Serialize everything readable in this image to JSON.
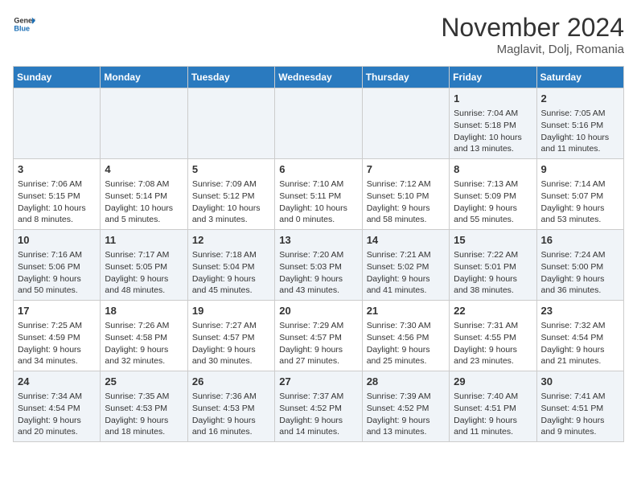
{
  "header": {
    "logo_line1": "General",
    "logo_line2": "Blue",
    "month": "November 2024",
    "location": "Maglavit, Dolj, Romania"
  },
  "weekdays": [
    "Sunday",
    "Monday",
    "Tuesday",
    "Wednesday",
    "Thursday",
    "Friday",
    "Saturday"
  ],
  "weeks": [
    [
      {
        "day": "",
        "info": ""
      },
      {
        "day": "",
        "info": ""
      },
      {
        "day": "",
        "info": ""
      },
      {
        "day": "",
        "info": ""
      },
      {
        "day": "",
        "info": ""
      },
      {
        "day": "1",
        "info": "Sunrise: 7:04 AM\nSunset: 5:18 PM\nDaylight: 10 hours and 13 minutes."
      },
      {
        "day": "2",
        "info": "Sunrise: 7:05 AM\nSunset: 5:16 PM\nDaylight: 10 hours and 11 minutes."
      }
    ],
    [
      {
        "day": "3",
        "info": "Sunrise: 7:06 AM\nSunset: 5:15 PM\nDaylight: 10 hours and 8 minutes."
      },
      {
        "day": "4",
        "info": "Sunrise: 7:08 AM\nSunset: 5:14 PM\nDaylight: 10 hours and 5 minutes."
      },
      {
        "day": "5",
        "info": "Sunrise: 7:09 AM\nSunset: 5:12 PM\nDaylight: 10 hours and 3 minutes."
      },
      {
        "day": "6",
        "info": "Sunrise: 7:10 AM\nSunset: 5:11 PM\nDaylight: 10 hours and 0 minutes."
      },
      {
        "day": "7",
        "info": "Sunrise: 7:12 AM\nSunset: 5:10 PM\nDaylight: 9 hours and 58 minutes."
      },
      {
        "day": "8",
        "info": "Sunrise: 7:13 AM\nSunset: 5:09 PM\nDaylight: 9 hours and 55 minutes."
      },
      {
        "day": "9",
        "info": "Sunrise: 7:14 AM\nSunset: 5:07 PM\nDaylight: 9 hours and 53 minutes."
      }
    ],
    [
      {
        "day": "10",
        "info": "Sunrise: 7:16 AM\nSunset: 5:06 PM\nDaylight: 9 hours and 50 minutes."
      },
      {
        "day": "11",
        "info": "Sunrise: 7:17 AM\nSunset: 5:05 PM\nDaylight: 9 hours and 48 minutes."
      },
      {
        "day": "12",
        "info": "Sunrise: 7:18 AM\nSunset: 5:04 PM\nDaylight: 9 hours and 45 minutes."
      },
      {
        "day": "13",
        "info": "Sunrise: 7:20 AM\nSunset: 5:03 PM\nDaylight: 9 hours and 43 minutes."
      },
      {
        "day": "14",
        "info": "Sunrise: 7:21 AM\nSunset: 5:02 PM\nDaylight: 9 hours and 41 minutes."
      },
      {
        "day": "15",
        "info": "Sunrise: 7:22 AM\nSunset: 5:01 PM\nDaylight: 9 hours and 38 minutes."
      },
      {
        "day": "16",
        "info": "Sunrise: 7:24 AM\nSunset: 5:00 PM\nDaylight: 9 hours and 36 minutes."
      }
    ],
    [
      {
        "day": "17",
        "info": "Sunrise: 7:25 AM\nSunset: 4:59 PM\nDaylight: 9 hours and 34 minutes."
      },
      {
        "day": "18",
        "info": "Sunrise: 7:26 AM\nSunset: 4:58 PM\nDaylight: 9 hours and 32 minutes."
      },
      {
        "day": "19",
        "info": "Sunrise: 7:27 AM\nSunset: 4:57 PM\nDaylight: 9 hours and 30 minutes."
      },
      {
        "day": "20",
        "info": "Sunrise: 7:29 AM\nSunset: 4:57 PM\nDaylight: 9 hours and 27 minutes."
      },
      {
        "day": "21",
        "info": "Sunrise: 7:30 AM\nSunset: 4:56 PM\nDaylight: 9 hours and 25 minutes."
      },
      {
        "day": "22",
        "info": "Sunrise: 7:31 AM\nSunset: 4:55 PM\nDaylight: 9 hours and 23 minutes."
      },
      {
        "day": "23",
        "info": "Sunrise: 7:32 AM\nSunset: 4:54 PM\nDaylight: 9 hours and 21 minutes."
      }
    ],
    [
      {
        "day": "24",
        "info": "Sunrise: 7:34 AM\nSunset: 4:54 PM\nDaylight: 9 hours and 20 minutes."
      },
      {
        "day": "25",
        "info": "Sunrise: 7:35 AM\nSunset: 4:53 PM\nDaylight: 9 hours and 18 minutes."
      },
      {
        "day": "26",
        "info": "Sunrise: 7:36 AM\nSunset: 4:53 PM\nDaylight: 9 hours and 16 minutes."
      },
      {
        "day": "27",
        "info": "Sunrise: 7:37 AM\nSunset: 4:52 PM\nDaylight: 9 hours and 14 minutes."
      },
      {
        "day": "28",
        "info": "Sunrise: 7:39 AM\nSunset: 4:52 PM\nDaylight: 9 hours and 13 minutes."
      },
      {
        "day": "29",
        "info": "Sunrise: 7:40 AM\nSunset: 4:51 PM\nDaylight: 9 hours and 11 minutes."
      },
      {
        "day": "30",
        "info": "Sunrise: 7:41 AM\nSunset: 4:51 PM\nDaylight: 9 hours and 9 minutes."
      }
    ]
  ]
}
